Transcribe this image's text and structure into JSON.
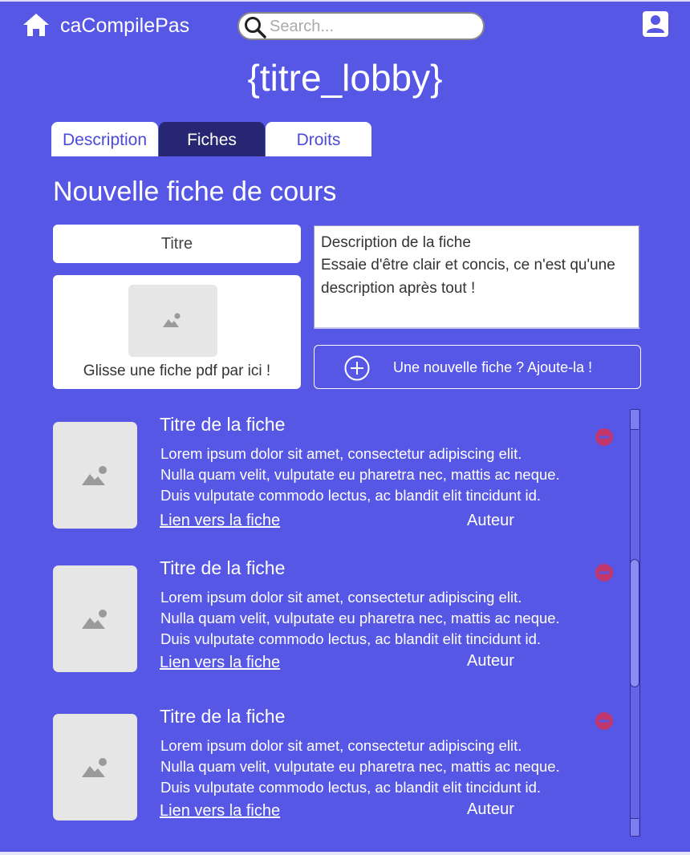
{
  "header": {
    "brand": "caCompilePas",
    "search_placeholder": "Search..."
  },
  "lobby_title": "{titre_lobby}",
  "tabs": [
    {
      "label": "Description",
      "active": false
    },
    {
      "label": "Fiches",
      "active": true
    },
    {
      "label": "Droits",
      "active": false
    }
  ],
  "form": {
    "section_title": "Nouvelle fiche de cours",
    "title_placeholder": "Titre",
    "dropzone_label": "Glisse une fiche pdf par ici !",
    "description_line1": "Description de la fiche",
    "description_line2": "Essaie d'être clair et concis, ce n'est qu'une description après tout !",
    "add_button": "Une nouvelle fiche ? Ajoute-la !"
  },
  "fiches": [
    {
      "title": "Titre de la fiche",
      "desc_lines": [
        "Lorem ipsum dolor sit amet, consectetur adipiscing elit.",
        "Nulla quam velit, vulputate eu pharetra nec, mattis ac neque.",
        "Duis vulputate commodo lectus, ac blandit elit tincidunt id."
      ],
      "link": "Lien vers la fiche",
      "author": "Auteur"
    },
    {
      "title": "Titre de la fiche",
      "desc_lines": [
        "Lorem ipsum dolor sit amet, consectetur adipiscing elit.",
        "Nulla quam velit, vulputate eu pharetra nec, mattis ac neque.",
        "Duis vulputate commodo lectus, ac blandit elit tincidunt id."
      ],
      "link": "Lien vers la fiche",
      "author": "Auteur"
    },
    {
      "title": "Titre de la fiche",
      "desc_lines": [
        "Lorem ipsum dolor sit amet, consectetur adipiscing elit.",
        "Nulla quam velit, vulputate eu pharetra nec, mattis ac neque.",
        "Duis vulputate commodo lectus, ac blandit elit tincidunt id."
      ],
      "link": "Lien vers la fiche",
      "author": "Auteur"
    }
  ],
  "icons": {
    "home": "home-icon",
    "search": "search-icon",
    "user": "account-icon",
    "image": "image-placeholder-icon",
    "add": "plus-circle-icon",
    "remove": "minus-circle-icon"
  },
  "colors": {
    "background": "#5757e6",
    "active_tab": "#262673",
    "remove": "#c2366e"
  }
}
